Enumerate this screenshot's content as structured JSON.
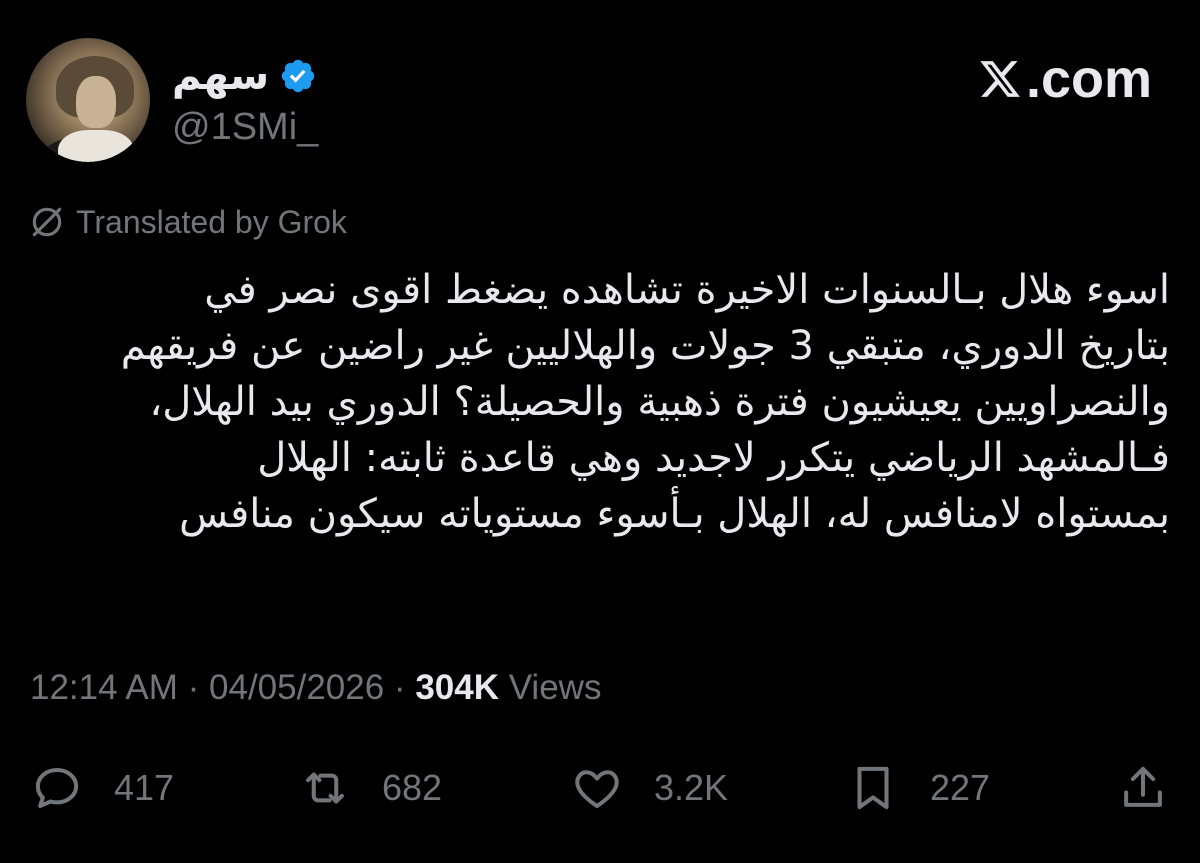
{
  "author": {
    "display_name": "سهم",
    "handle": "@1SMi_",
    "verified": true,
    "verified_color": "#1d9bf0"
  },
  "brand": {
    "label": ".com",
    "icon": "x-logo-icon"
  },
  "translation": {
    "label": "Translated by Grok",
    "icon": "translate-slash-icon"
  },
  "tweet": {
    "lines": [
      "اسوء هلال بـالسنوات الاخيرة تشاهده يضغط اقوى نصر في",
      "بتاريخ الدوري، متبقي 3 جولات والهلاليين غير راضين عن فريقهم",
      "والنصراويين يعيشيون فترة ذهبية والحصيلة؟ الدوري بيد الهلال،",
      "فـالمشهد الرياضي يتكرر لاجديد وهي قاعدة ثابته: الهلال",
      "بمستواه لامنافس له، الهلال بـأسوء مستوياته سيكون منافس"
    ]
  },
  "meta": {
    "time": "12:14 AM",
    "separator": "·",
    "date": "04/05/2026",
    "views_count": "304K",
    "views_label": "Views"
  },
  "actions": {
    "reply": {
      "icon": "reply-icon",
      "count": "417"
    },
    "repost": {
      "icon": "repost-icon",
      "count": "682"
    },
    "like": {
      "icon": "heart-icon",
      "count": "3.2K"
    },
    "bookmark": {
      "icon": "bookmark-icon",
      "count": "227"
    },
    "share": {
      "icon": "share-icon"
    }
  },
  "colors": {
    "background": "#000000",
    "primary_text": "#e7e9ea",
    "secondary_text": "#71767b",
    "verified": "#1d9bf0"
  }
}
